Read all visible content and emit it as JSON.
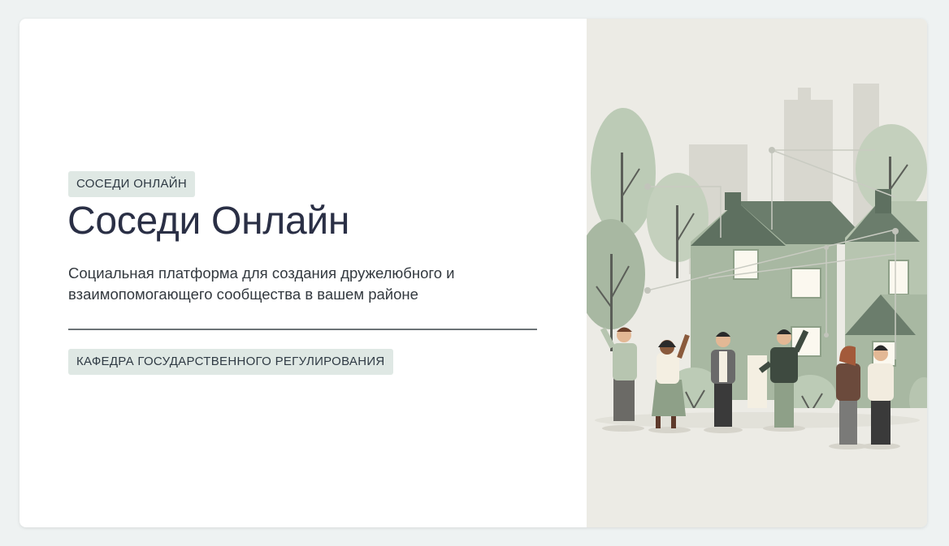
{
  "hero": {
    "eyebrow": "СОСЕДИ ОНЛАЙН",
    "title": "Соседи Онлайн",
    "description": "Социальная платформа для создания дружелюбного и взаимопомогающего сообщества в вашем районе",
    "department": "КАФЕДРА ГОСУДАРСТВЕННОГО РЕГУЛИРОВАНИЯ"
  },
  "illustration": {
    "subject": "neighbors-community-illustration",
    "palette": {
      "sage": "#a8b8a2",
      "sage_light": "#c4cfbe",
      "sage_dark": "#5e7060",
      "background": "#ecebe5",
      "window": "#fbf8ef",
      "text_dark": "#2a2f45",
      "badge_bg": "#dfe8e4"
    }
  }
}
